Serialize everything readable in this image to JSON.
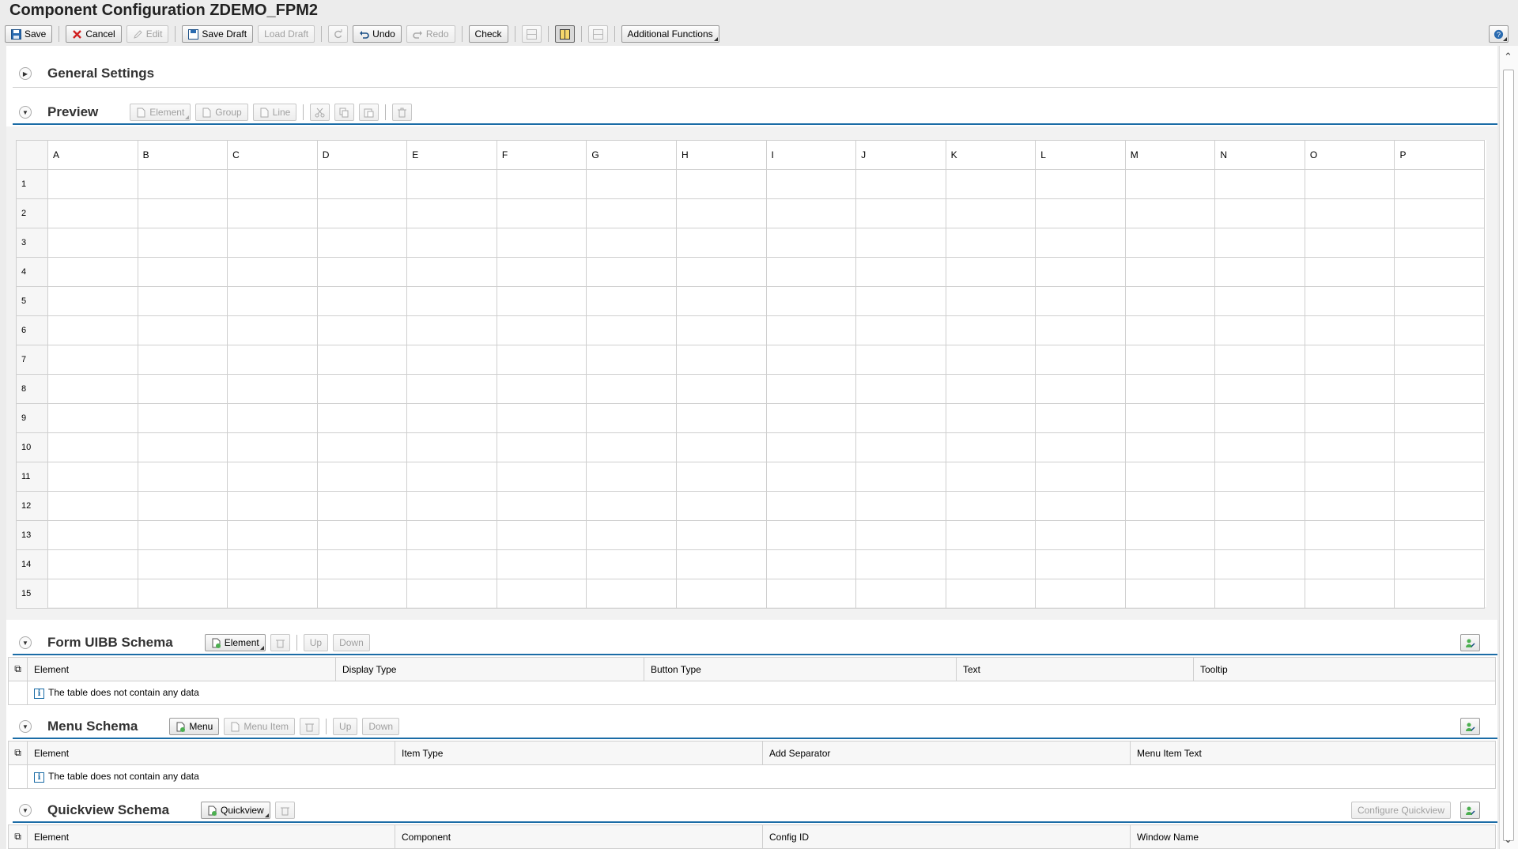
{
  "window": {
    "title": "Component Configuration ZDEMO_FPM2"
  },
  "toolbar": {
    "save": "Save",
    "cancel": "Cancel",
    "edit": "Edit",
    "save_draft": "Save Draft",
    "load_draft": "Load Draft",
    "undo": "Undo",
    "redo": "Redo",
    "check": "Check",
    "additional_functions": "Additional Functions"
  },
  "general_settings": {
    "title": "General Settings"
  },
  "preview": {
    "title": "Preview",
    "buttons": {
      "element": "Element",
      "group": "Group",
      "line": "Line"
    },
    "columns": [
      "A",
      "B",
      "C",
      "D",
      "E",
      "F",
      "G",
      "H",
      "I",
      "J",
      "K",
      "L",
      "M",
      "N",
      "O",
      "P"
    ],
    "rows": [
      "1",
      "2",
      "3",
      "4",
      "5",
      "6",
      "7",
      "8",
      "9",
      "10",
      "11",
      "12",
      "13",
      "14",
      "15"
    ]
  },
  "form_schema": {
    "title": "Form UIBB Schema",
    "buttons": {
      "element": "Element",
      "up": "Up",
      "down": "Down"
    },
    "columns": [
      "Element",
      "Display Type",
      "Button Type",
      "Text",
      "Tooltip"
    ],
    "empty_text": "The table does not contain any data"
  },
  "menu_schema": {
    "title": "Menu Schema",
    "buttons": {
      "menu": "Menu",
      "menu_item": "Menu Item",
      "up": "Up",
      "down": "Down"
    },
    "columns": [
      "Element",
      "Item Type",
      "Add Separator",
      "Menu Item Text"
    ],
    "empty_text": "The table does not contain any data"
  },
  "quickview_schema": {
    "title": "Quickview Schema",
    "buttons": {
      "quickview": "Quickview",
      "configure": "Configure Quickview"
    },
    "columns": [
      "Element",
      "Component",
      "Config ID",
      "Window Name"
    ]
  },
  "colors": {
    "accent": "#1b6ca6",
    "background": "#ececec"
  }
}
